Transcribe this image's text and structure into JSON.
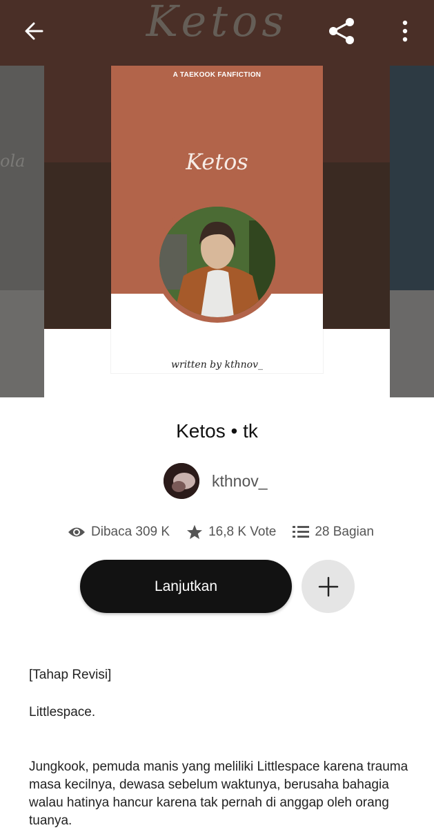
{
  "header": {
    "background_title": "Ketos",
    "back_icon": "arrow-left-icon",
    "share_icon": "share-icon",
    "more_icon": "more-vertical-icon"
  },
  "cover": {
    "subtitle": "A TAEKOOK FANFICTION",
    "title": "Ketos",
    "author_signature": "written by kthnov_",
    "side_left_script": "ola",
    "colors": {
      "cover": "#b2644a",
      "hero_bg": "#4a2f27"
    }
  },
  "story": {
    "title": "Ketos • tk",
    "author": "kthnov_"
  },
  "stats": {
    "reads": "Dibaca 309 K",
    "votes": "16,8 K Vote",
    "parts": "28 Bagian"
  },
  "actions": {
    "continue_label": "Lanjutkan",
    "add_icon": "plus-icon"
  },
  "description": {
    "line1": "[Tahap Revisi]",
    "line2": "Littlespace.",
    "line3": "Jungkook, pemuda manis yang meliliki Littlespace karena trauma masa kecilnya, dewasa sebelum waktunya, berusaha bahagia walau hatinya hancur karena tak pernah di anggap oleh orang tuanya."
  }
}
